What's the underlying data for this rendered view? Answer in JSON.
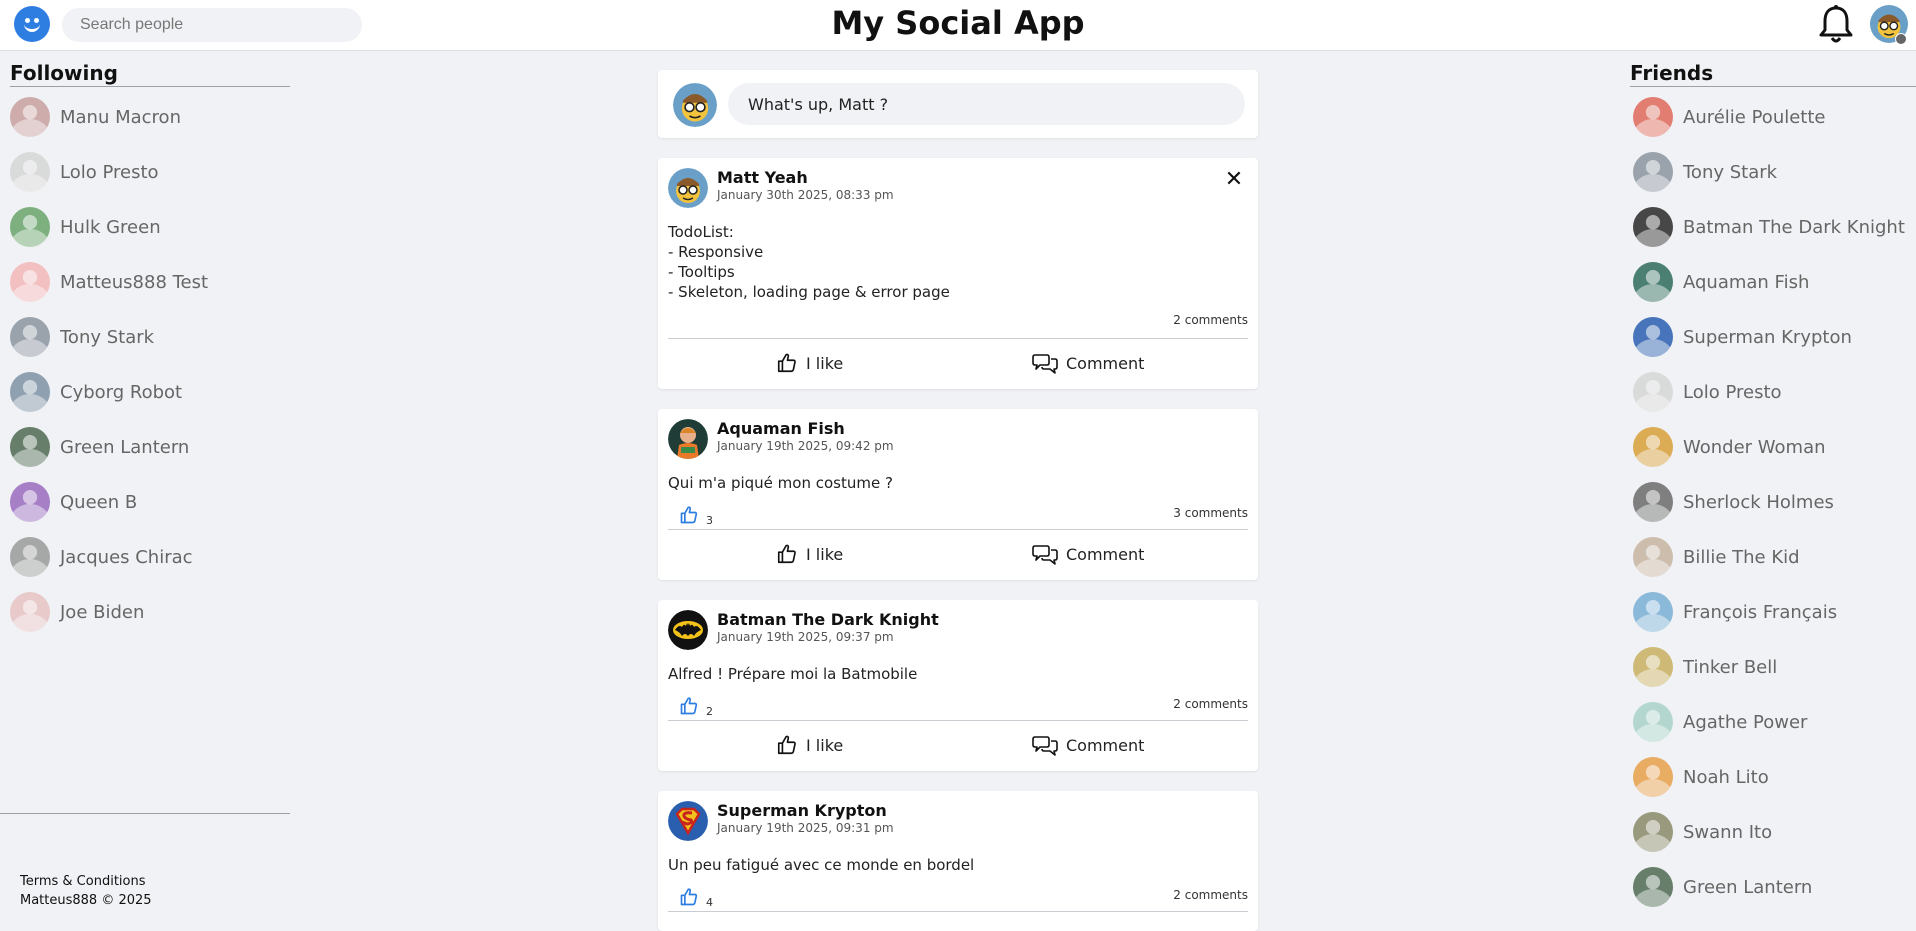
{
  "header": {
    "title": "My Social App",
    "search_placeholder": "Search people",
    "logo_icon": "smiley-logo-icon",
    "bell_icon": "bell-icon",
    "accent": "#2e7de1"
  },
  "following": {
    "title": "Following",
    "items": [
      {
        "name": "Manu Macron",
        "color": "#c9a0a0"
      },
      {
        "name": "Lolo Presto",
        "color": "#d6d6d6"
      },
      {
        "name": "Hulk Green",
        "color": "#6aa56a"
      },
      {
        "name": "Matteus888 Test",
        "color": "#f4b8b8"
      },
      {
        "name": "Tony Stark",
        "color": "#8c96a0"
      },
      {
        "name": "Cyborg Robot",
        "color": "#7f93a6"
      },
      {
        "name": "Green Lantern",
        "color": "#4f6a52"
      },
      {
        "name": "Queen B",
        "color": "#9a6bc0"
      },
      {
        "name": "Jacques Chirac",
        "color": "#9a9a9a"
      },
      {
        "name": "Joe Biden",
        "color": "#e8c4c4"
      }
    ]
  },
  "footer": {
    "terms": "Terms & Conditions",
    "copyright": "Matteus888 © 2025"
  },
  "composer": {
    "placeholder": "What's up, Matt ?"
  },
  "posts": [
    {
      "author": "Matt Yeah",
      "date": "January 30th 2025, 08:33 pm",
      "body": "TodoList:\n- Responsive\n- Tooltips\n- Skeleton, loading page & error page",
      "likes": "",
      "comments": "2 comments",
      "like_label": "I like",
      "comment_label": "Comment"
    },
    {
      "author": "Aquaman Fish",
      "date": "January 19th 2025, 09:42 pm",
      "body": "Qui m'a piqué mon costume ?",
      "likes": "3",
      "comments": "3 comments",
      "like_label": "I like",
      "comment_label": "Comment"
    },
    {
      "author": "Batman The Dark Knight",
      "date": "January 19th 2025, 09:37 pm",
      "body": "Alfred ! Prépare moi la Batmobile",
      "likes": "2",
      "comments": "2 comments",
      "like_label": "I like",
      "comment_label": "Comment"
    },
    {
      "author": "Superman Krypton",
      "date": "January 19th 2025, 09:31 pm",
      "body": "Un peu fatigué avec ce monde en bordel",
      "likes": "4",
      "comments": "2 comments",
      "like_label": "I like",
      "comment_label": "Comment"
    }
  ],
  "friends": {
    "title": "Friends",
    "items": [
      {
        "name": "Aurélie Poulette",
        "color": "#e06a5a"
      },
      {
        "name": "Tony Stark",
        "color": "#8c96a0"
      },
      {
        "name": "Batman The Dark Knight",
        "color": "#2a2a2a"
      },
      {
        "name": "Aquaman Fish",
        "color": "#2f6b5a"
      },
      {
        "name": "Superman Krypton",
        "color": "#2a5fb0"
      },
      {
        "name": "Lolo Presto",
        "color": "#d6d6d6"
      },
      {
        "name": "Wonder Woman",
        "color": "#d9a03a"
      },
      {
        "name": "Sherlock Holmes",
        "color": "#6c6c6c"
      },
      {
        "name": "Billie The Kid",
        "color": "#c8b4a0"
      },
      {
        "name": "François Français",
        "color": "#7ab0d6"
      },
      {
        "name": "Tinker Bell",
        "color": "#c9b060"
      },
      {
        "name": "Agathe Power",
        "color": "#a9d3c8"
      },
      {
        "name": "Noah Lito",
        "color": "#e8a04a"
      },
      {
        "name": "Swann Ito",
        "color": "#8a8a6a"
      },
      {
        "name": "Green Lantern",
        "color": "#4f6a52"
      }
    ]
  }
}
